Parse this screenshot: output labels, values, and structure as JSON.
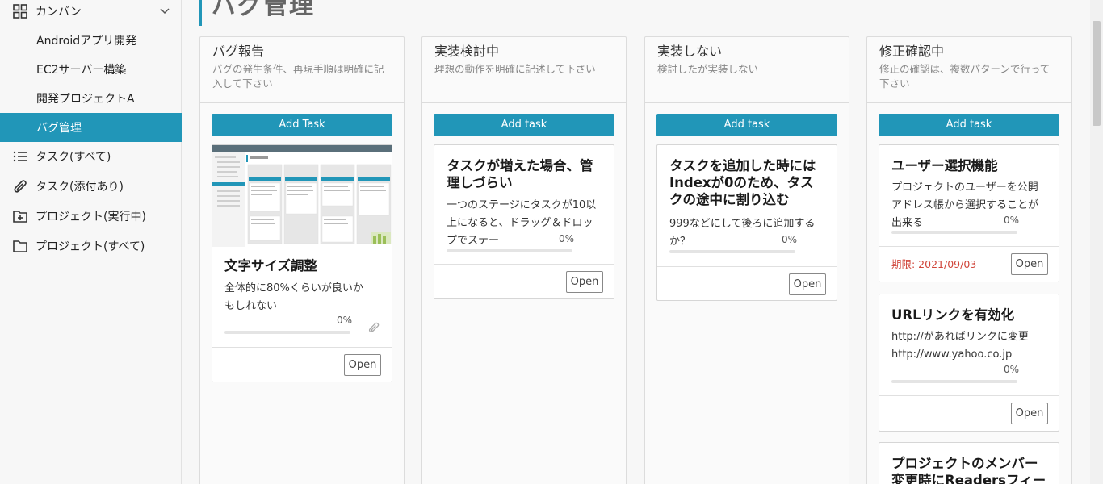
{
  "sidebar": {
    "kanban_label": "カンバン",
    "projects": [
      "Androidアプリ開発",
      "EC2サーバー構築",
      "開発プロジェクトA",
      "バグ管理"
    ],
    "links": [
      "タスク(すべて)",
      "タスク(添付あり)",
      "プロジェクト(実行中)",
      "プロジェクト(すべて)"
    ]
  },
  "page": {
    "title": "バグ管理"
  },
  "columns": [
    {
      "title": "バグ報告",
      "desc": "バグの発生条件、再現手順は明確に記入して下さい",
      "add_label": "Add Task",
      "cards": [
        {
          "title": "文字サイズ調整",
          "text": "全体的に80%くらいが良いかもしれない",
          "progress": "0%",
          "open": "Open"
        }
      ]
    },
    {
      "title": "実装検討中",
      "desc": "理想の動作を明確に記述して下さい",
      "add_label": "Add task",
      "cards": [
        {
          "title": "タスクが増えた場合、管理しづらい",
          "text": "一つのステージにタスクが10以上になると、ドラッグ＆ドロップでステー",
          "progress": "0%",
          "open": "Open"
        }
      ]
    },
    {
      "title": "実装しない",
      "desc": "検討したが実装しない",
      "add_label": "Add task",
      "cards": [
        {
          "title": "タスクを追加した時にはIndexが0のため、タスクの途中に割り込む",
          "text": "999などにして後ろに追加するか？",
          "progress": "0%",
          "open": "Open"
        }
      ]
    },
    {
      "title": "修正確認中",
      "desc": "修正の確認は、複数パターンで行って下さい",
      "add_label": "Add task",
      "cards": [
        {
          "title": "ユーザー選択機能",
          "text": "プロジェクトのユーザーを公開アドレス帳から選択することが出来る",
          "progress": "0%",
          "due": "期限: 2021/09/03",
          "open": "Open"
        },
        {
          "title": "URLリンクを有効化",
          "text1": "http://があればリンクに変更",
          "text2": "http://www.yahoo.co.jp",
          "progress": "0%",
          "open": "Open"
        },
        {
          "title": "プロジェクトのメンバー変更時にReadersフィールドを"
        }
      ]
    }
  ],
  "colors": {
    "accent": "#2196b8",
    "due": "#d0453a"
  }
}
